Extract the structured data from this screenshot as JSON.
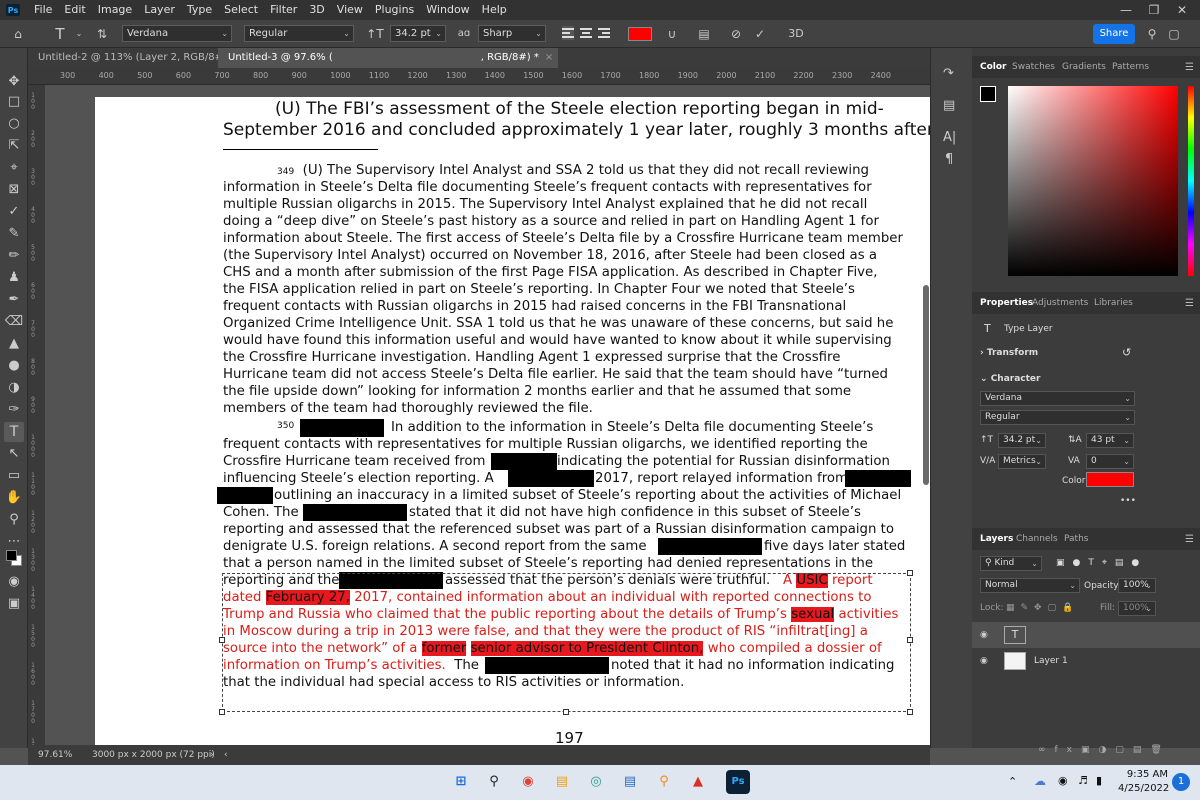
{
  "app": {
    "logo": "Ps",
    "menu": [
      "File",
      "Edit",
      "Image",
      "Layer",
      "Type",
      "Select",
      "Filter",
      "3D",
      "View",
      "Plugins",
      "Window",
      "Help"
    ]
  },
  "options": {
    "font_family": "Verdana",
    "font_style": "Regular",
    "font_size": "34.2 pt",
    "aa_label": "aɑ",
    "antialias": "Sharp",
    "color": "#ff0000",
    "three_d": "3D",
    "share": "Share"
  },
  "tabs": [
    {
      "label": "Untitled-2 @ 113% (Layer 2, RGB/8#) *",
      "close": "×"
    },
    {
      "label": "Untitled-3 @ 97.6% (",
      "label2": ", RGB/8#) *",
      "close": "×"
    }
  ],
  "ruler": [
    "300",
    "400",
    "500",
    "600",
    "700",
    "800",
    "900",
    "1000",
    "1100",
    "1200",
    "1300",
    "1400",
    "1500",
    "1600",
    "1700",
    "1800",
    "1900",
    "2000",
    "2100",
    "2200",
    "2300",
    "2400"
  ],
  "ruler_left": [
    "100",
    "200",
    "300",
    "400",
    "500",
    "600",
    "700",
    "800",
    "900",
    "1000",
    "1100",
    "1200",
    "1300",
    "1400",
    "1500",
    "1600",
    "1700",
    "1800"
  ],
  "document": {
    "heading": [
      "(U)  The FBI’s assessment of the Steele election reporting began in mid-",
      "September 2016 and concluded approximately 1 year later, roughly 3 months after"
    ],
    "fn349_num": "349",
    "fn349": [
      "(U)  The Supervisory Intel Analyst and SSA 2 told us that they did not recall reviewing",
      "information in Steele’s Delta file documenting Steele’s frequent contacts with representatives for",
      "multiple Russian oligarchs in 2015.  The Supervisory Intel Analyst explained that he did not recall",
      "doing a “deep dive” on Steele’s past history as a source and relied in part on Handling Agent 1 for",
      "information about Steele.  The first access of Steele’s Delta file by a Crossfire Hurricane team member",
      "(the Supervisory Intel Analyst) occurred on November 18, 2016, after Steele had been closed as a",
      "CHS and a month after submission of the first Page FISA application.  As described in Chapter Five,",
      "the FISA application relied in part on Steele’s reporting.  In Chapter Four we noted that Steele’s",
      "frequent contacts with Russian oligarchs in 2015 had raised concerns in the FBI Transnational",
      "Organized Crime Intelligence Unit.  SSA 1 told us that he was unaware of these concerns, but said he",
      "would have found this information useful and would have wanted to know about it while supervising",
      "the Crossfire Hurricane investigation.  Handling Agent 1 expressed surprise that the Crossfire",
      "Hurricane team did not access Steele’s Delta file earlier.  He said that the team should have “turned",
      "the file upside down” looking for information 2 months earlier and that he assumed that some",
      "members of the team had thoroughly reviewed the file."
    ],
    "fn350_num": "350",
    "fn350": {
      "l1": "In addition to the information in Steele’s Delta file documenting Steele’s",
      "l2": "frequent contacts with representatives for multiple Russian oligarchs, we identified reporting the",
      "l3a": "Crossfire Hurricane team received from",
      "l3b": "indicating the potential for Russian disinformation",
      "l4a": "influencing Steele’s election reporting.  A",
      "l4b": "2017, report relayed information from",
      "l5": "outlining an inaccuracy in a limited subset of Steele’s reporting about the activities of Michael",
      "l6a": "Cohen.  The",
      "l6b": "stated that it did not have high confidence in this subset of Steele’s",
      "l7": "reporting and assessed that the referenced subset was part of a Russian disinformation campaign to",
      "l8a": "denigrate U.S. foreign relations.  A second report from the same",
      "l8b": "five days later stated",
      "l9": "that a person named in the limited subset of Steele’s reporting had denied representations in the",
      "l10a": "reporting and the",
      "l10b": "assessed that the person’s denials were truthful.",
      "l10c": "A",
      "l10d": "USIC",
      "l10e": "report",
      "l11a": "dated",
      "l11b": "February 27,",
      "l11c": "2017, contained information about an individual with reported connections to",
      "l12a": "Trump and Russia who claimed that the public reporting about the details of Trump’s",
      "l12b": "sexual",
      "l12c": "activities",
      "l13": "in Moscow during a trip in 2013 were false, and that they were the product of RIS “infiltrat[ing] a",
      "l14a": "source into the network” of a",
      "l14b": "former",
      "l14c": "senior advisor to President Clinton,",
      "l14d": "who compiled a dossier of",
      "l15a": "information on Trump’s activities.",
      "l15b": "The",
      "l15c": "noted that it had no information indicating",
      "l16": "that the individual had special access to RIS activities or information."
    },
    "page_number": "197"
  },
  "right_panel": {
    "color_tabs": [
      "Color",
      "Swatches",
      "Gradients",
      "Patterns"
    ],
    "props_tabs": [
      "Properties",
      "Adjustments",
      "Libraries"
    ],
    "layer_type": "Type Layer",
    "transform": "Transform",
    "character": "Character",
    "char_font": "Verdana",
    "char_style": "Regular",
    "char_size": "34.2 pt",
    "char_leading": "43 pt",
    "kerning": "Metrics",
    "tracking": "0",
    "color_label": "Color",
    "more": "•••",
    "layers_tabs": [
      "Layers",
      "Channels",
      "Paths"
    ],
    "kind": "Kind",
    "blend": "Normal",
    "opacity_label": "Opacity:",
    "opacity": "100%",
    "lock_label": "Lock:",
    "fill_label": "Fill:",
    "fill": "100%",
    "layers": [
      {
        "name": ""
      },
      {
        "name": "Layer 1"
      }
    ]
  },
  "status": {
    "zoom": "97.61%",
    "info": "3000 px x 2000 px (72 ppi)"
  },
  "taskbar": {
    "time": "9:35 AM",
    "date": "4/25/2022",
    "notif": "1"
  },
  "colors": {
    "accent": "#1473e6",
    "redact": "#000000",
    "highlight": "#e8181f",
    "red_text": "#d91e18"
  }
}
